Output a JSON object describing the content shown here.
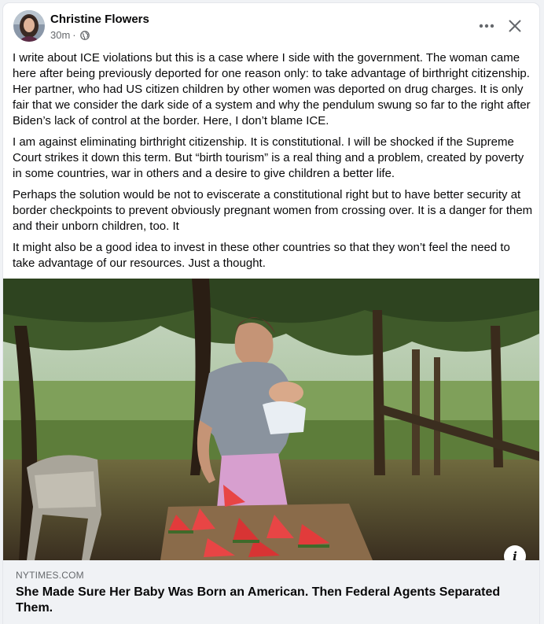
{
  "post": {
    "author": "Christine Flowers",
    "time": "30m",
    "separator": "·",
    "audience_icon": "globe-icon",
    "paragraphs": [
      "I write about ICE violations but this is a case where I side with the government. The woman came here after being previously deported for one reason only: to take advantage of birthright citizenship. Her partner, who had US citizen children by other women was deported on drug charges. It is only fair that we consider the dark side of a system and why the pendulum swung so far to the right after Biden’s lack of control at the border. Here, I don’t blame ICE.",
      "I am against eliminating birthright citizenship. It is constitutional. I will be shocked if the Supreme Court strikes it down this term. But “birth tourism” is a real thing and a problem, created by poverty in some countries, war in others and a desire to give children a better life.",
      "Perhaps the solution would be not to eviscerate a constitutional right but to have better security at border checkpoints to prevent obviously pregnant women from crossing over. It is a danger for them and their unborn children, too. It",
      "It might also be a good idea to invest in these other countries so that they won’t feel the need to take advantage of our resources. Just a thought."
    ]
  },
  "controls": {
    "more_icon": "more-horizontal-icon",
    "close_icon": "close-icon",
    "info_label": "i"
  },
  "link": {
    "domain": "NYTIMES.COM",
    "headline": "She Made Sure Her Baby Was Born an American. Then Federal Agents Separated Them."
  },
  "colors": {
    "background": "#f0f2f5",
    "card": "#ffffff",
    "text": "#080809",
    "secondary_text": "#65686c"
  }
}
